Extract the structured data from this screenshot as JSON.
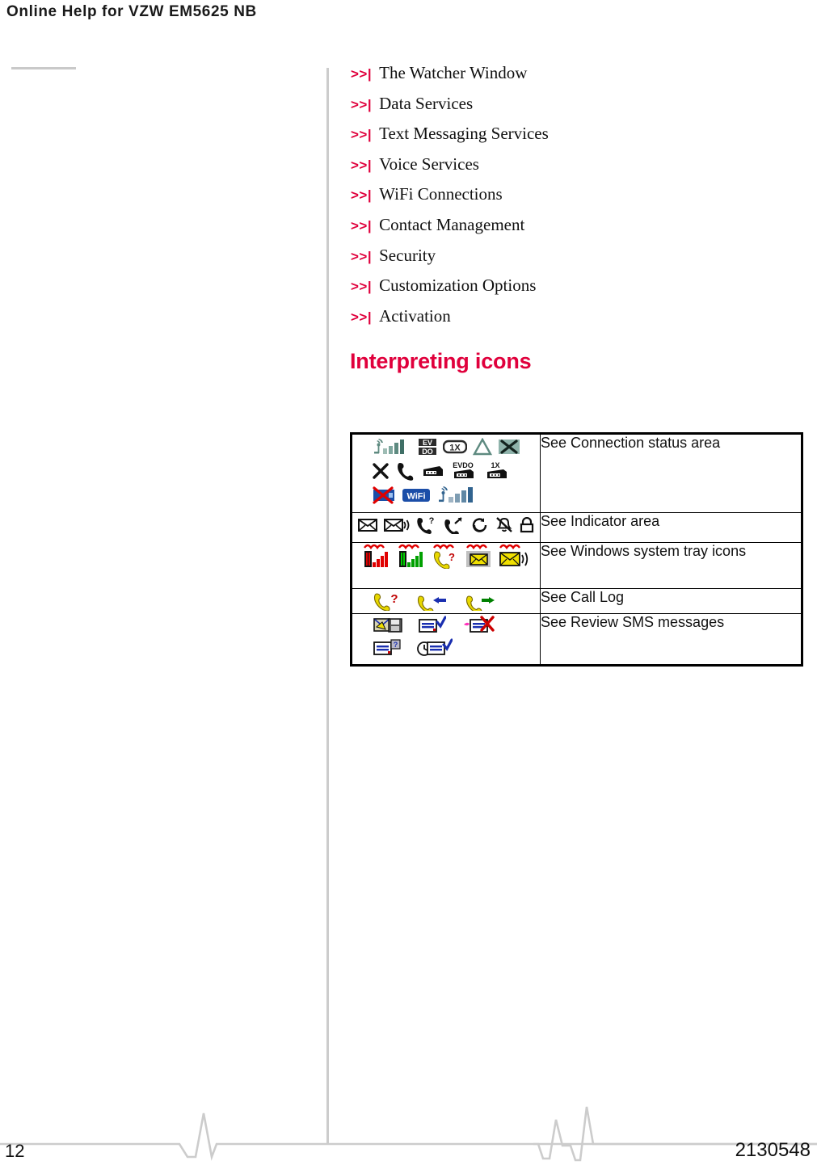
{
  "header": {
    "running_title": "Online Help for VZW EM5625 NB"
  },
  "xref_list": {
    "marker": ">>|",
    "items": [
      {
        "label": "The Watcher Window"
      },
      {
        "label": "Data Services"
      },
      {
        "label": "Text Messaging Services"
      },
      {
        "label": "Voice Services"
      },
      {
        "label": "WiFi Connections"
      },
      {
        "label": "Contact Management"
      },
      {
        "label": "Security"
      },
      {
        "label": "Customization Options"
      },
      {
        "label": "Activation"
      }
    ]
  },
  "section": {
    "heading": "Interpreting icons"
  },
  "icon_table": {
    "rows": [
      {
        "label": "See Connection status area",
        "icon_groups": [
          [
            "antenna-signal-bars-icon",
            "evdo-block-icon",
            "onex-box-icon",
            "triangle-icon",
            "x-box-icon"
          ],
          [
            "x-icon",
            "phone-handset-icon",
            "modem-icon",
            "evdo-modem-icon",
            "onex-modem-icon"
          ],
          [
            "wifi-disconnected-icon",
            "wifi-badge-icon",
            "wifi-antenna-bars-icon"
          ]
        ]
      },
      {
        "label": "See Indicator area",
        "icon_groups": [
          [
            "envelope-icon",
            "envelope-sound-icon",
            "phone-question-icon",
            "phone-arrow-icon",
            "roaming-icon",
            "bell-muted-icon",
            "padlock-icon"
          ]
        ]
      },
      {
        "label": "See Windows system tray icons",
        "icon_groups": [
          [
            "tray-signal-red-icon",
            "tray-signal-green-icon",
            "tray-phone-question-icon",
            "tray-envelope-icon",
            "tray-envelope-sound-icon"
          ]
        ]
      },
      {
        "label": "See Call Log",
        "icon_groups": [
          [
            "call-missed-icon",
            "call-incoming-icon",
            "call-outgoing-icon"
          ]
        ]
      },
      {
        "label": "See Review SMS messages",
        "icon_groups": [
          [
            "sms-save-icon",
            "sms-sent-icon",
            "sms-failed-icon"
          ],
          [
            "sms-unknown-icon",
            "sms-pending-icon"
          ]
        ]
      }
    ]
  },
  "footer": {
    "page_number": "12",
    "document_number": "2130548"
  },
  "colors": {
    "accent_red": "#e0003c",
    "rule_gray": "#cccccc",
    "text_black": "#111111"
  }
}
